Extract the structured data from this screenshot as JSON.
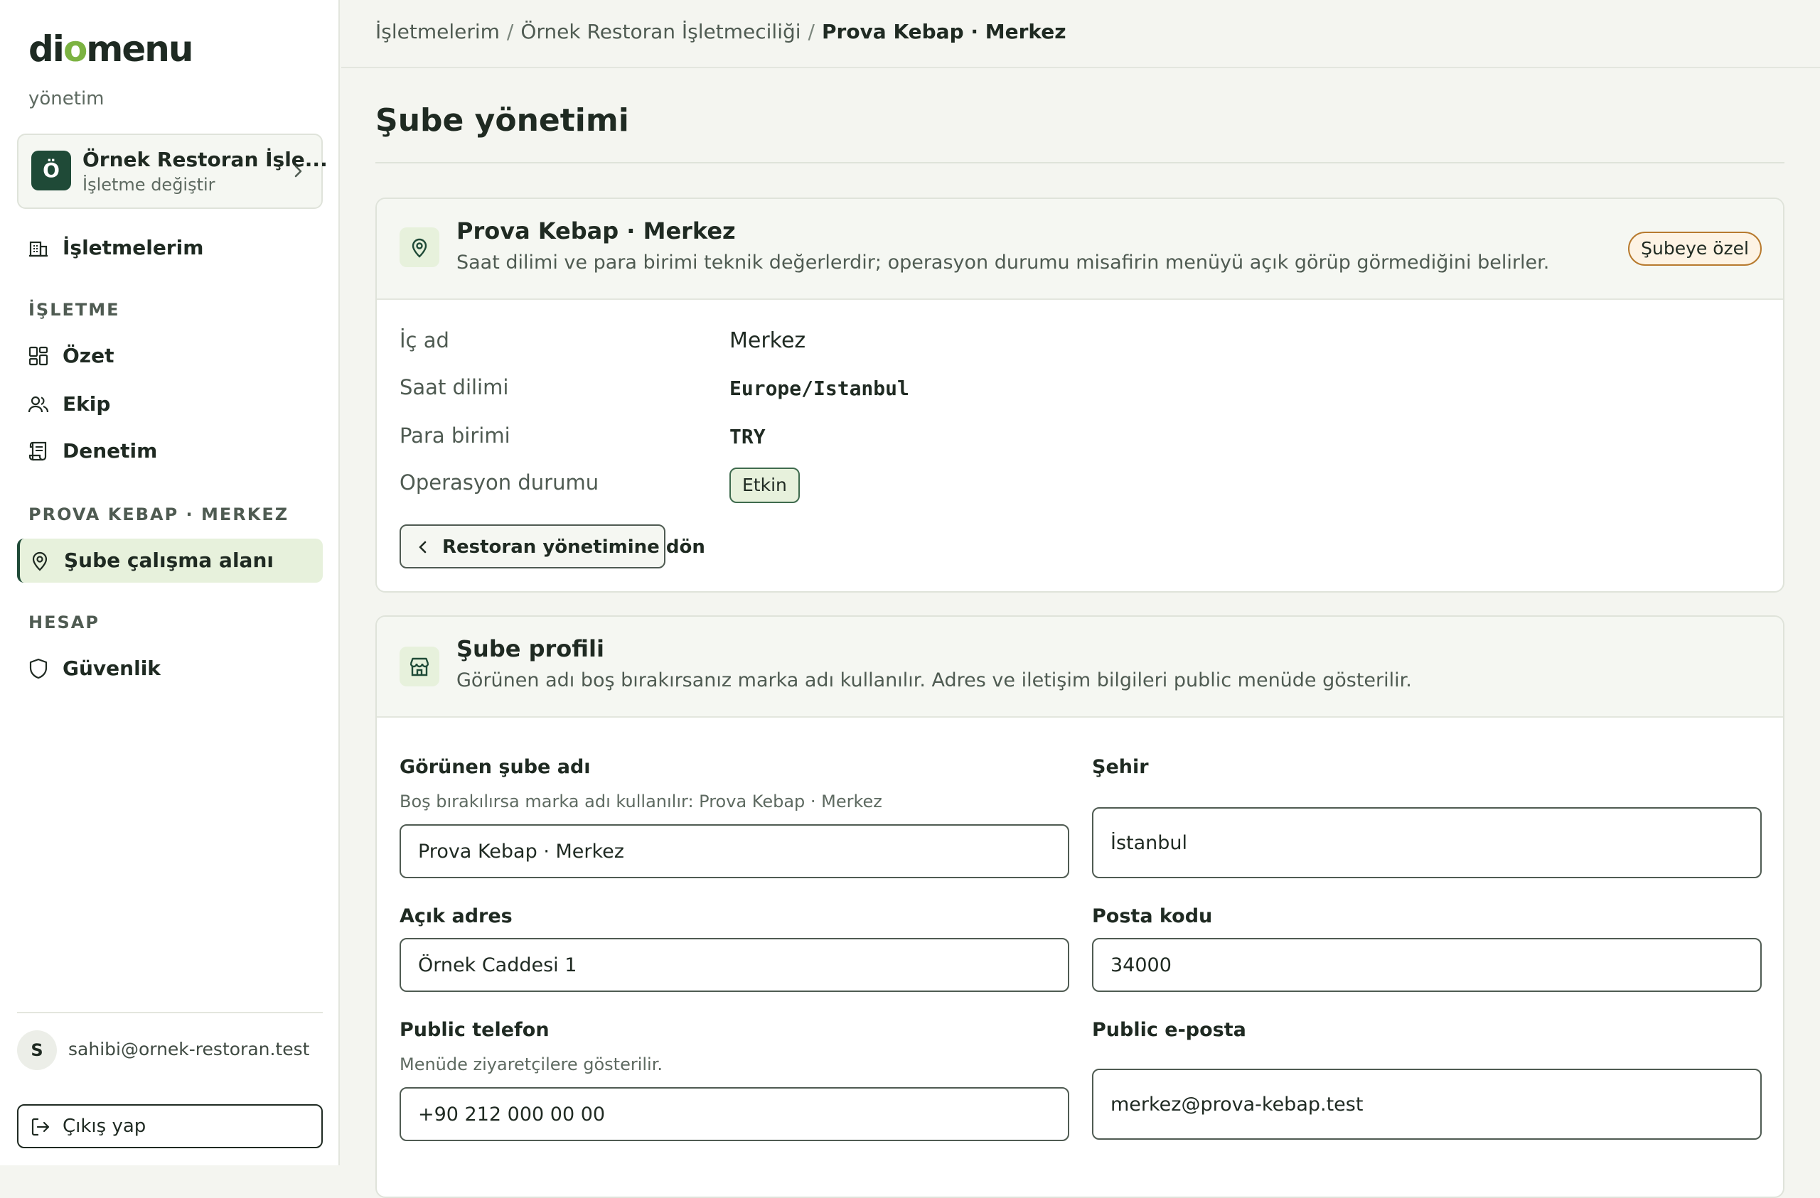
{
  "sidebar": {
    "logo": "diomenu",
    "logo_sub": "yönetim",
    "business": {
      "avatar": "Ö",
      "name": "Örnek Restoran İşle...",
      "switch_label": "İşletme değiştir"
    },
    "top_item": {
      "label": "İşletmelerim",
      "icon": "building-icon"
    },
    "sections": [
      {
        "title": "İŞLETME"
      },
      {
        "title": "PROVA KEBAP · MERKEZ"
      },
      {
        "title": "HESAP"
      }
    ],
    "items": [
      {
        "label": "Özet",
        "icon": "dashboard-icon"
      },
      {
        "label": "Ekip",
        "icon": "users-icon"
      },
      {
        "label": "Denetim",
        "icon": "scroll-icon"
      },
      {
        "label": "Şube çalışma alanı",
        "icon": "map-pin-icon",
        "active": true
      },
      {
        "label": "Güvenlik",
        "icon": "shield-icon"
      }
    ],
    "user": {
      "avatar": "S",
      "email": "sahibi@ornek-restoran.test"
    },
    "logout_label": "Çıkış yap"
  },
  "breadcrumb": {
    "items": [
      "İşletmelerim",
      "Örnek Restoran İşletmeciliği"
    ],
    "separator": "/",
    "current": "Prova Kebap · Merkez"
  },
  "page": {
    "title": "Şube yönetimi"
  },
  "branch_card": {
    "title": "Prova Kebap · Merkez",
    "description": "Saat dilimi ve para birimi teknik değerlerdir; operasyon durumu misafirin menüyü açık görüp görmediğini belirler.",
    "badge": "Şubeye özel",
    "fields": [
      {
        "label": "İç ad",
        "value": "Merkez"
      },
      {
        "label": "Saat dilimi",
        "value": "Europe/Istanbul"
      },
      {
        "label": "Para birimi",
        "value": "TRY"
      },
      {
        "label": "Operasyon durumu",
        "value": "Etkin"
      }
    ],
    "back_button": "Restoran yönetimine dön"
  },
  "profile_card": {
    "title": "Şube profili",
    "description": "Görünen adı boş bırakırsanız marka adı kullanılır. Adres ve iletişim bilgileri public menüde gösterilir.",
    "display_name": {
      "label": "Görünen şube adı",
      "help": "Boş bırakılırsa marka adı kullanılır: Prova Kebap · Merkez",
      "value": "Prova Kebap · Merkez"
    },
    "city": {
      "label": "Şehir",
      "value": "İstanbul"
    },
    "address": {
      "label": "Açık adres",
      "value": "Örnek Caddesi 1"
    },
    "postal_code": {
      "label": "Posta kodu",
      "value": "34000"
    },
    "phone": {
      "label": "Public telefon",
      "help": "Menüde ziyaretçilere gösterilir.",
      "value": "+90 212 000 00 00"
    },
    "email": {
      "label": "Public e-posta",
      "value": "merkez@prova-kebap.test"
    }
  },
  "colors": {
    "brand_dark": "#1f4a37",
    "accent_light": "#e7f1dc",
    "brand_green": "#7cb342",
    "badge_border": "#b77a2e"
  }
}
